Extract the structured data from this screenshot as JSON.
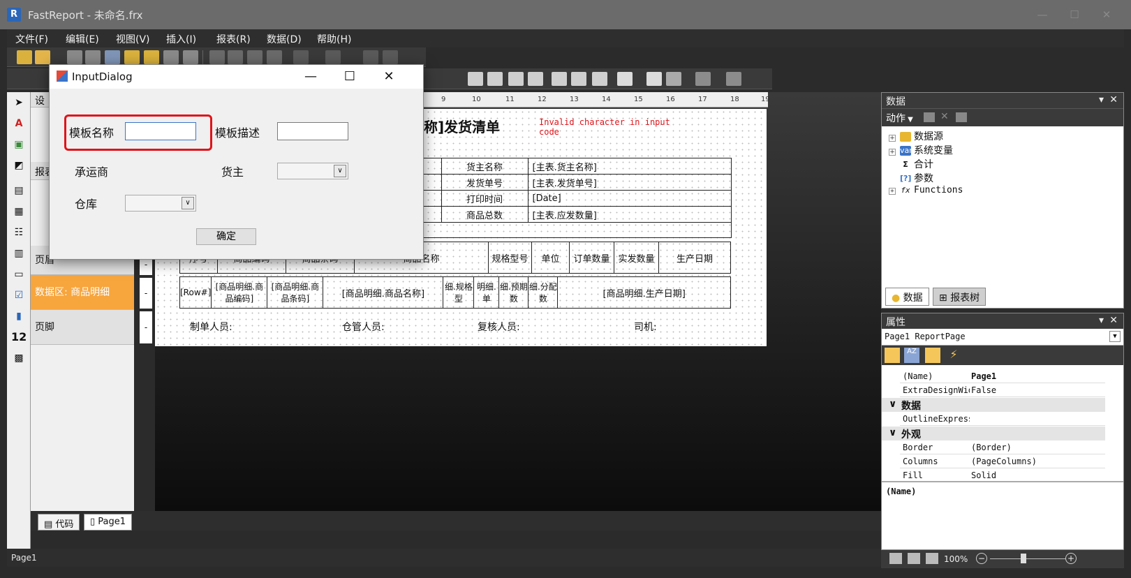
{
  "window": {
    "title": "FastReport - 未命名.frx",
    "logo": "R",
    "minimize": "—",
    "maximize": "☐",
    "close": "✕"
  },
  "menu": [
    "文件(F)",
    "编辑(E)",
    "视图(V)",
    "插入(I)",
    "报表(R)",
    "数据(D)",
    "帮助(H)"
  ],
  "bands": {
    "design_label": "设",
    "report_label": "报表",
    "header": "页眉",
    "data": "数据区: 商品明细",
    "footer": "页脚"
  },
  "report": {
    "title_fragment": "名称]发货清单",
    "error_text": "Invalid character in input code",
    "info_rows": [
      {
        "label": "货主名称",
        "value": "[主表.货主名称]"
      },
      {
        "label": "发货单号",
        "value": "[主表.发货单号]"
      },
      {
        "label": "打印时间",
        "value": "[Date]"
      },
      {
        "label": "商品总数",
        "value": "[主表.应发数量]"
      }
    ],
    "col_headers": [
      "序号",
      "商品编码",
      "商品条码",
      "商品名称",
      "规格型号",
      "单位",
      "订单数量",
      "实发数量",
      "生产日期"
    ],
    "data_row": [
      "[Row#]",
      "[商品明细.商品编码]",
      "[商品明细.商品条码]",
      "[商品明细.商品名称]",
      "细.规格型",
      "明细.单",
      "细.预期数",
      "细.分配数",
      "[商品明细.生产日期]"
    ],
    "footer_fields": [
      "制单人员:",
      "仓管人员:",
      "复核人员:",
      "司机:"
    ]
  },
  "ruler": [
    "9",
    "10",
    "11",
    "12",
    "13",
    "14",
    "15",
    "16",
    "17",
    "18",
    "19"
  ],
  "tabs": {
    "code": "代码",
    "page": "Page1"
  },
  "status": {
    "text": "Page1",
    "zoom": "100%"
  },
  "data_panel": {
    "title": "数据",
    "action": "动作",
    "tree": [
      "数据源",
      "系统变量",
      "合计",
      "参数",
      "Functions"
    ],
    "tab_data": "数据",
    "tab_tree": "报表树"
  },
  "props_panel": {
    "title": "属性",
    "selector": "Page1 ReportPage",
    "rows": [
      {
        "name": "(Name)",
        "value": "Page1"
      },
      {
        "name": "ExtraDesignWidth",
        "value": "False"
      }
    ],
    "cat_data": "数据",
    "rows2": [
      {
        "name": "OutlineExpression",
        "value": ""
      }
    ],
    "cat_look": "外观",
    "rows3": [
      {
        "name": "Border",
        "value": "(Border)"
      },
      {
        "name": "Columns",
        "value": "(PageColumns)"
      },
      {
        "name": "Fill",
        "value": "Solid"
      }
    ],
    "desc": "(Name)"
  },
  "dialog": {
    "title": "InputDialog",
    "template_name_label": "模板名称",
    "template_name_value": "",
    "template_desc_label": "模板描述",
    "template_desc_value": "",
    "carrier_label": "承运商",
    "owner_label": "货主",
    "warehouse_label": "仓库",
    "ok": "确定"
  },
  "colors": {
    "highlight": "#e0141a",
    "band_active": "#f7a53d",
    "error": "#e0141a"
  }
}
